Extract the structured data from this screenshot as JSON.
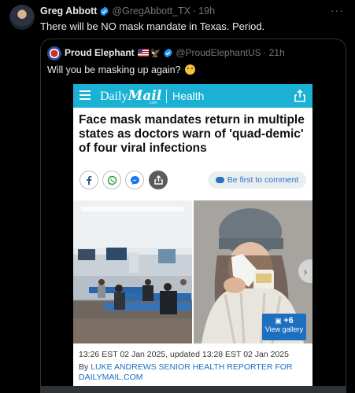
{
  "tweet": {
    "name": "Greg Abbott",
    "handle": "@GregAbbott_TX",
    "time": "19h",
    "separator": "·",
    "text": "There will be NO mask mandate in Texas. Period.",
    "more_label": "···"
  },
  "quote": {
    "name": "Proud Elephant",
    "handle": "@ProudElephantUS",
    "time": "21h",
    "separator": "·",
    "text": "Will you be masking up again?"
  },
  "article": {
    "brand": "Daily",
    "brand_bold": "Mail",
    "brand_suffix": ".com",
    "section": "Health",
    "headline": "Face mask mandates return in multiple states as doctors warn of 'quad-demic' of four viral infections",
    "comment_label": "Be first to comment",
    "gallery_count": "+6",
    "gallery_label": "View gallery",
    "dateline": "13:26 EST 02 Jan 2025, updated 13:28 EST 02 Jan 2025",
    "byline_prefix": "By",
    "byline_author": "LUKE ANDREWS SENIOR HEALTH REPORTER FOR DAILYMAIL.COM"
  },
  "colors": {
    "background": "#000000",
    "dm_accent": "#1ab1d4",
    "verified": "#1d9bf0",
    "link": "#1a6fc2"
  },
  "icons": [
    "verified-icon",
    "more-icon",
    "flag-icon",
    "eagle-icon",
    "thinking-emoji-icon",
    "hamburger-icon",
    "share-icon",
    "facebook-icon",
    "whatsapp-icon",
    "messenger-icon",
    "comment-icon",
    "gallery-icon",
    "chevron-right-icon"
  ]
}
